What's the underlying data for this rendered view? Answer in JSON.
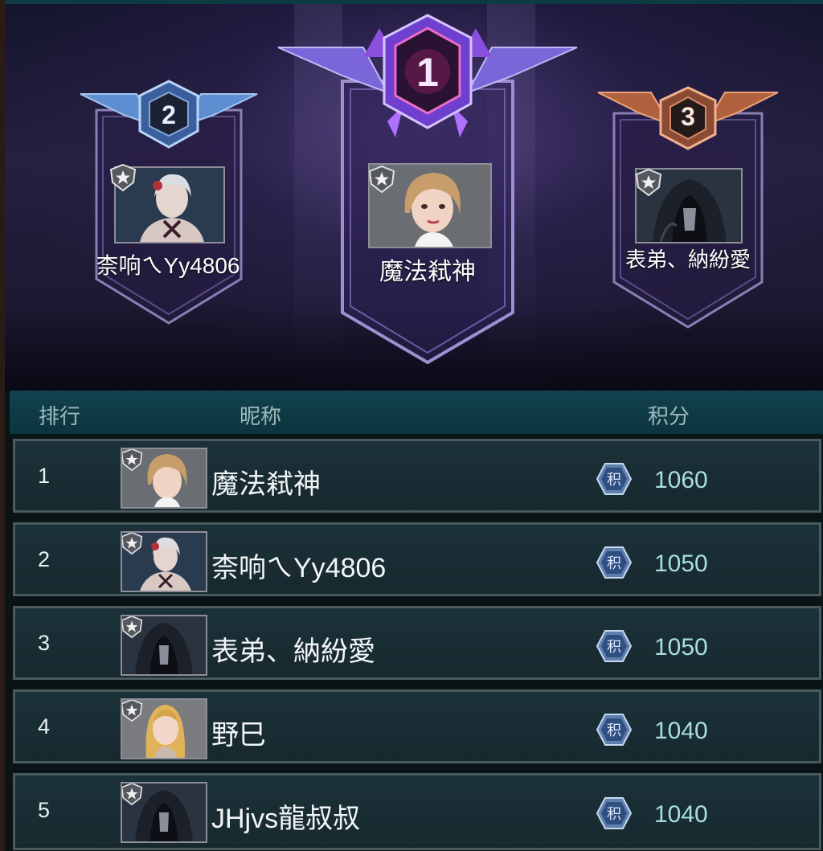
{
  "podium": [
    {
      "place": "2",
      "name": "柰响ㄟYy4806",
      "avatar": "white-hair-girl-avatar"
    },
    {
      "place": "1",
      "name": "魔法弒神",
      "avatar": "blonde-bob-girl-avatar"
    },
    {
      "place": "3",
      "name": "表弟、納紛愛",
      "avatar": "hooded-reaper-avatar"
    }
  ],
  "header": {
    "rank": "排行",
    "nickname": "昵称",
    "score": "积分"
  },
  "score_icon_label": "积",
  "rows": [
    {
      "rank": "1",
      "name": "魔法弒神",
      "score": "1060",
      "avatar": "blonde-bob-girl-avatar"
    },
    {
      "rank": "2",
      "name": "柰响ㄟYy4806",
      "score": "1050",
      "avatar": "white-hair-girl-avatar"
    },
    {
      "rank": "3",
      "name": "表弟、納紛愛",
      "score": "1050",
      "avatar": "hooded-reaper-avatar"
    },
    {
      "rank": "4",
      "name": "野巳",
      "score": "1040",
      "avatar": "blonde-long-hair-girl-avatar"
    },
    {
      "rank": "5",
      "name": "JHjvs龍叔叔",
      "score": "1040",
      "avatar": "hooded-reaper-avatar"
    }
  ],
  "colors": {
    "gold_badge": "#8a3fd8",
    "silver_badge": "#4f7fc4",
    "bronze_badge": "#c06a44",
    "accent": "#a9dde4"
  }
}
